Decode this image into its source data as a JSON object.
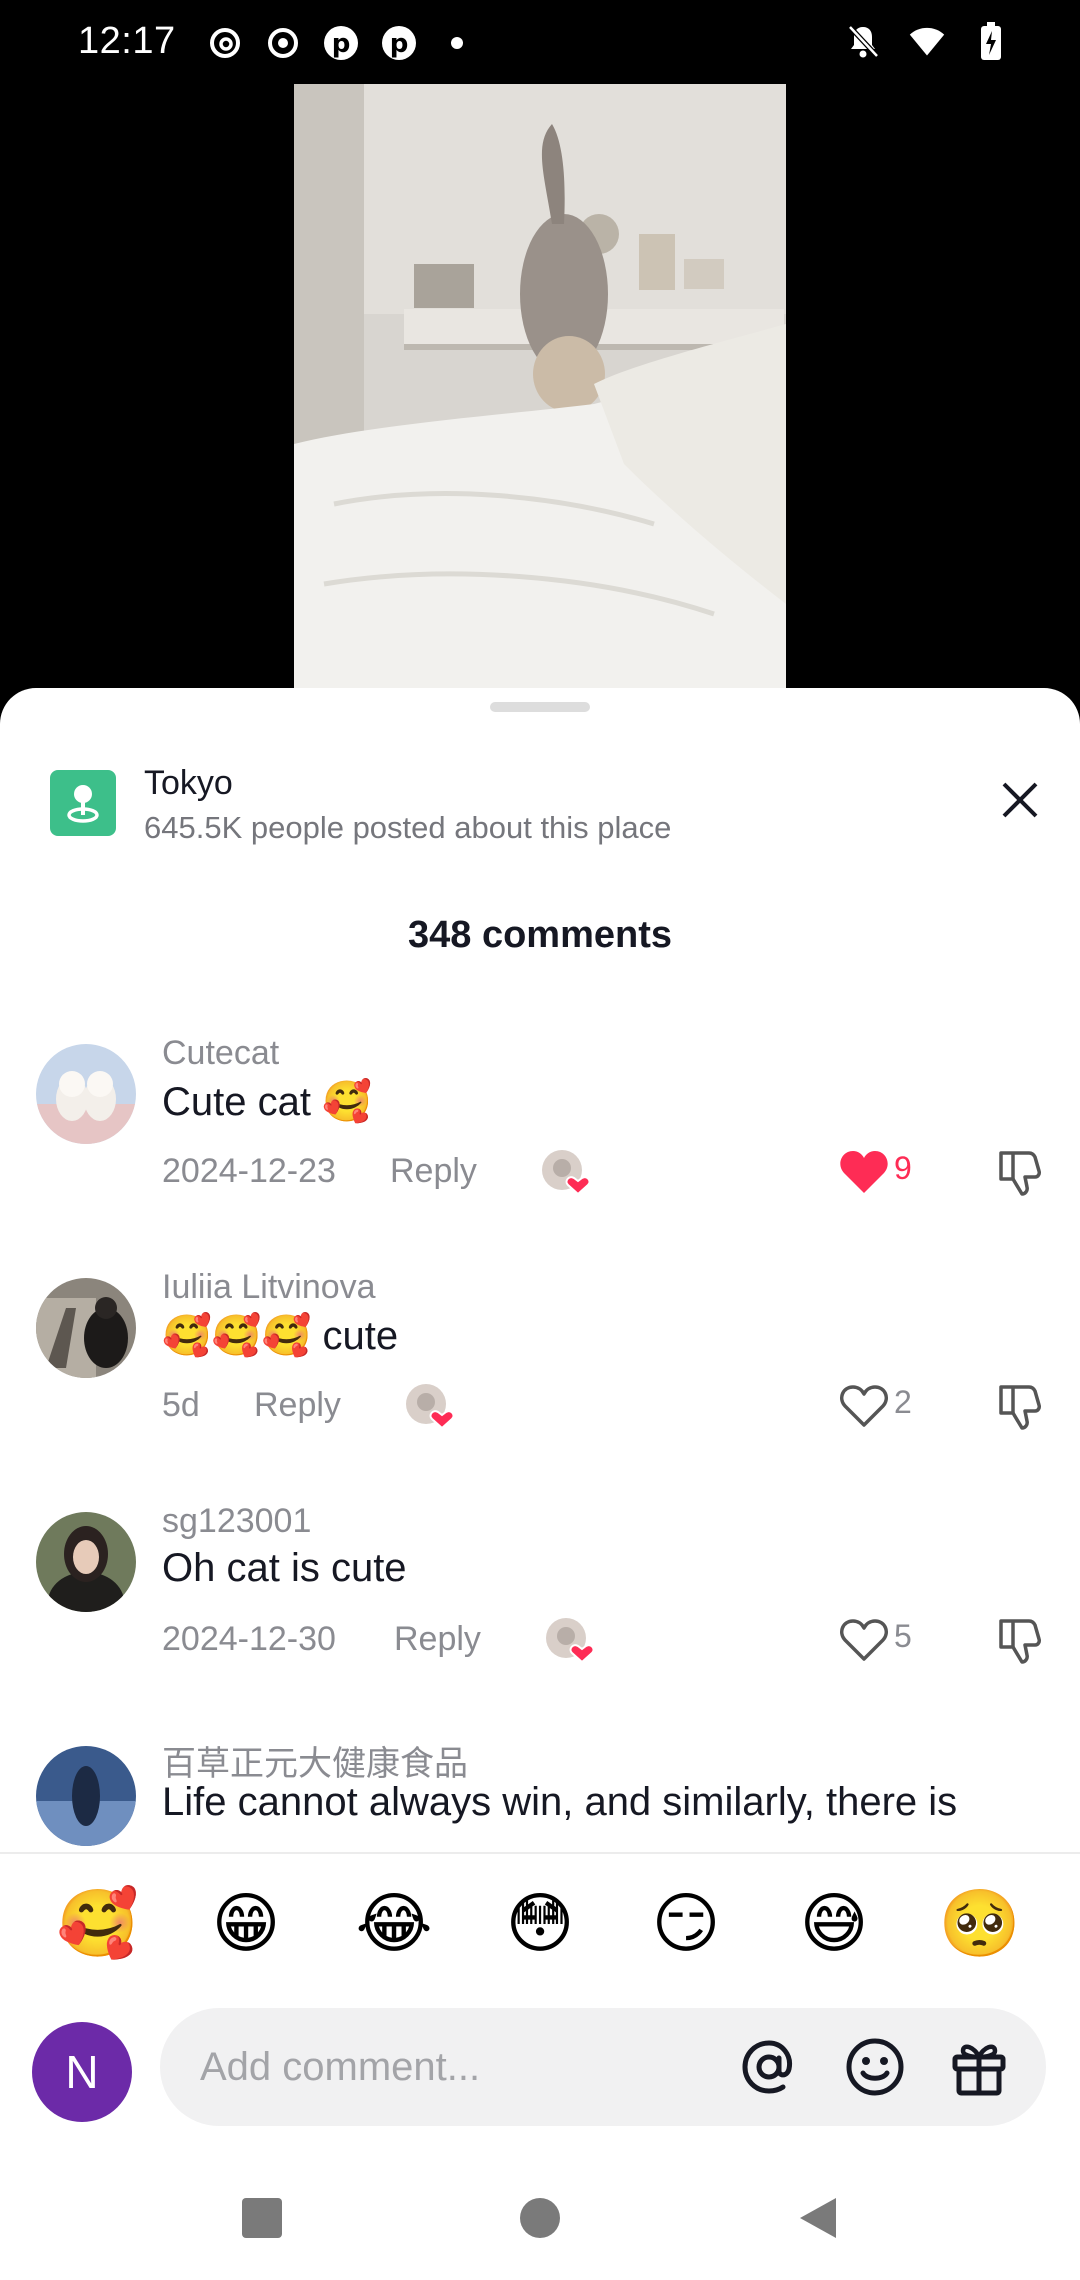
{
  "status_bar": {
    "time": "12:17",
    "left_icons": [
      "threads-icon",
      "record-icon",
      "pinterest-icon",
      "pinterest-icon",
      "dot-icon"
    ],
    "right_icons": [
      "bell-off-icon",
      "wifi-icon",
      "battery-charging-icon"
    ]
  },
  "place": {
    "title": "Tokyo",
    "subtitle": "645.5K people posted about this place",
    "icon": "location-pin-icon",
    "icon_color": "#3dbf8a"
  },
  "comments_header": "348 comments",
  "comments": [
    {
      "user": "Cutecat",
      "text": "Cute cat 🥰",
      "date": "2024-12-23",
      "reply": "Reply",
      "likes": "9",
      "liked": true
    },
    {
      "user": "Iuliia Litvinova",
      "text": "🥰🥰🥰 cute",
      "date": "5d",
      "reply": "Reply",
      "likes": "2",
      "liked": false
    },
    {
      "user": "sg123001",
      "text": "Oh cat is cute",
      "date": "2024-12-30",
      "reply": "Reply",
      "likes": "5",
      "liked": false
    },
    {
      "user": "百草正元大健康食品",
      "text": "Life cannot always win, and similarly, there is"
    }
  ],
  "emoji_bar": [
    "🥰",
    "😁",
    "😂",
    "😳",
    "😏",
    "😅",
    "🥺"
  ],
  "input": {
    "avatar_letter": "N",
    "avatar_color": "#6c2aa8",
    "placeholder": "Add comment..."
  },
  "colors": {
    "like_red": "#fe2c55",
    "text_primary": "#161823",
    "text_secondary": "#8a8b91"
  }
}
